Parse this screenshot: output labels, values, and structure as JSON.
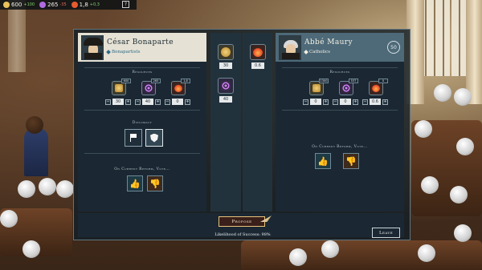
{
  "topbar": {
    "money": "600",
    "money_delta": "+100",
    "influence": "265",
    "influence_delta": "-35",
    "radicalism": "1,8",
    "radicalism_delta": "+0,3",
    "help_label": "?"
  },
  "left": {
    "name": "César Bonaparte",
    "faction": "Bonapartists",
    "resources_title": "Resources",
    "resources": [
      {
        "icon": "money-icon",
        "count": "600",
        "offer": "30"
      },
      {
        "icon": "influence-icon",
        "count": "265",
        "offer": "40"
      },
      {
        "icon": "radicalism-icon",
        "count": "1,8",
        "offer": "0"
      }
    ],
    "diplomacy_title": "Diplomacy",
    "vote_title": "On Current Reform, Vote..."
  },
  "right": {
    "name": "Abbé Maury",
    "faction": "Catholics",
    "age": "50",
    "resources_title": "Resources",
    "resources": [
      {
        "icon": "money-icon",
        "count": "1300",
        "offer": "0"
      },
      {
        "icon": "influence-icon",
        "count": "537",
        "offer": "0"
      },
      {
        "icon": "radicalism-icon",
        "count": "0",
        "offer": "0.6"
      }
    ],
    "vote_title": "On Current Reform, Vote..."
  },
  "middle": {
    "left_offers": [
      {
        "icon": "money-icon",
        "value": "30"
      },
      {
        "icon": "influence-icon",
        "value": "40"
      }
    ],
    "right_offers": [
      {
        "icon": "radicalism-icon",
        "value": "0.6"
      }
    ]
  },
  "footer": {
    "propose_label": "Propose",
    "likelihood": "Likelihood of Success: 98%",
    "leave_label": "Leave"
  },
  "colors": {
    "panel": "#1b2833",
    "accent_gold": "#e9c27a",
    "vote_yes": "#4ec7e0",
    "vote_no": "#f2a24a"
  }
}
